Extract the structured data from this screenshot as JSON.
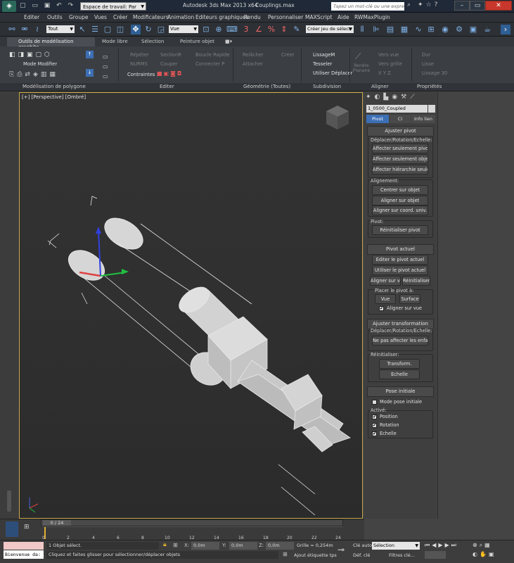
{
  "title_bar": {
    "workspace": "Espace de travail: Par",
    "app_title": "Autodesk 3ds Max  2013 x64",
    "file_name": "Couplings.max",
    "search_placeholder": "Tapez un mot-clé ou une expression"
  },
  "menu": [
    "Editer",
    "Outils",
    "Groupe",
    "Vues",
    "Créer",
    "Modificateurs",
    "Animation",
    "Editeurs graphiques",
    "Rendu",
    "Personnaliser",
    "MAXScript",
    "Aide",
    "RWMaxPlugin"
  ],
  "toolbar": {
    "filter": "Tout",
    "ref_coord": "Vue",
    "selection_set": "Créer jeu de sélect"
  },
  "ribbon_tabs": [
    "Outils de modélisation graphite",
    "Mode libre",
    "Sélection",
    "Peinture objet"
  ],
  "ribbon": {
    "mode_modifier": "Mode Modifier",
    "repeter": "Répéter",
    "nurms": "NURMS",
    "section": "SectionR",
    "couper": "Couper",
    "boucle_rapide": "Boucle Rapide",
    "connecter": "Connecter P",
    "contraintes": "Contraintes :",
    "relacher": "Relâcher",
    "creer": "Créer",
    "attacher": "Attacher",
    "lissage": "LissageM",
    "tesseler": "Tesseler",
    "utiliser_deplacer": "Utiliser Déplacer",
    "rendre_planaire": "Rendre Planaire",
    "vers_vue": "Vers vue",
    "vers_grille": "Vers grille",
    "xyz": "X  Y  Z",
    "dur": "Dur",
    "lisse": "Lisse",
    "lissage30": "Lissage 30"
  },
  "ribbon_footer": [
    "Modélisation de polygone",
    "Editer",
    "Géométrie (Toutes)",
    "Subdivision",
    "Aligner",
    "Propriétés"
  ],
  "viewport": {
    "label": "[+] [Perspective] [Ombré]"
  },
  "command_panel": {
    "object_name": "1_0500_Coupled",
    "tabs": [
      "Pivot",
      "CI",
      "Info lien"
    ],
    "ajuster_pivot": {
      "header": "Ajuster pivot",
      "group_move": "Déplacer/Rotation/Echelle:",
      "btn_pivot": "Affecter seulement pivot",
      "btn_objet": "Affecter seulement objet",
      "btn_hier": "Affecter hiérarchie seule",
      "group_align": "Alignement:",
      "btn_centrer": "Centrer sur objet",
      "btn_aligner_objet": "Aligner sur objet",
      "btn_aligner_coord": "Aligner sur coord. univ.",
      "group_pivot": "Pivot:",
      "btn_reinit": "Réinitialiser pivot"
    },
    "pivot_actuel": {
      "header": "Pivot actuel",
      "btn_editer": "Editer le pivot actuel",
      "btn_utiliser": "Utiliser le pivot actuel",
      "btn_aligner_vue": "Aligner sur vue",
      "btn_reinitialiser": "Réinitialiser",
      "group_placer": "Placer le pivot à:",
      "btn_vue": "Vue",
      "btn_surface": "Surface",
      "chk_aligner": "Aligner sur vue"
    },
    "ajuster_transformation": {
      "header": "Ajuster transformation",
      "group_move": "Déplacer/Rotation/Echelle:",
      "btn_ne_pas": "Ne pas affecter les enfants",
      "group_reinit": "Réinitialiser:",
      "btn_transform": "Transform.",
      "btn_echelle": "Echelle"
    },
    "pose_initiale": {
      "header": "Pose initiale",
      "chk_mode": "Mode pose initiale",
      "group_active": "Activé:",
      "chk_position": "Position",
      "chk_rotation": "Rotation",
      "chk_echelle": "Echelle"
    }
  },
  "timeline": {
    "frame": "0 / 24",
    "ticks": [
      "0",
      "2",
      "4",
      "6",
      "8",
      "10",
      "12",
      "14",
      "16",
      "18",
      "20",
      "22",
      "24"
    ]
  },
  "status": {
    "listener": "Bienvenue da:",
    "selected": "1 Objet sélect.",
    "hint": "Cliquez et faites glisser pour sélectionner/déplacer objets",
    "x": "0,0m",
    "y": "0,0m",
    "z": "0,0m",
    "grid": "Grille = 0,254m",
    "add_tag": "Ajout étiquette tps",
    "cle_auto": "Clé auto",
    "def_cle": "Déf. clé",
    "sel_mode": "Sélection",
    "filtres": "Filtres clé..."
  },
  "colors": {
    "viewport_border": "#c9a64a",
    "title_bg": "#1f2937",
    "tab_active": "#3d6fb5"
  }
}
